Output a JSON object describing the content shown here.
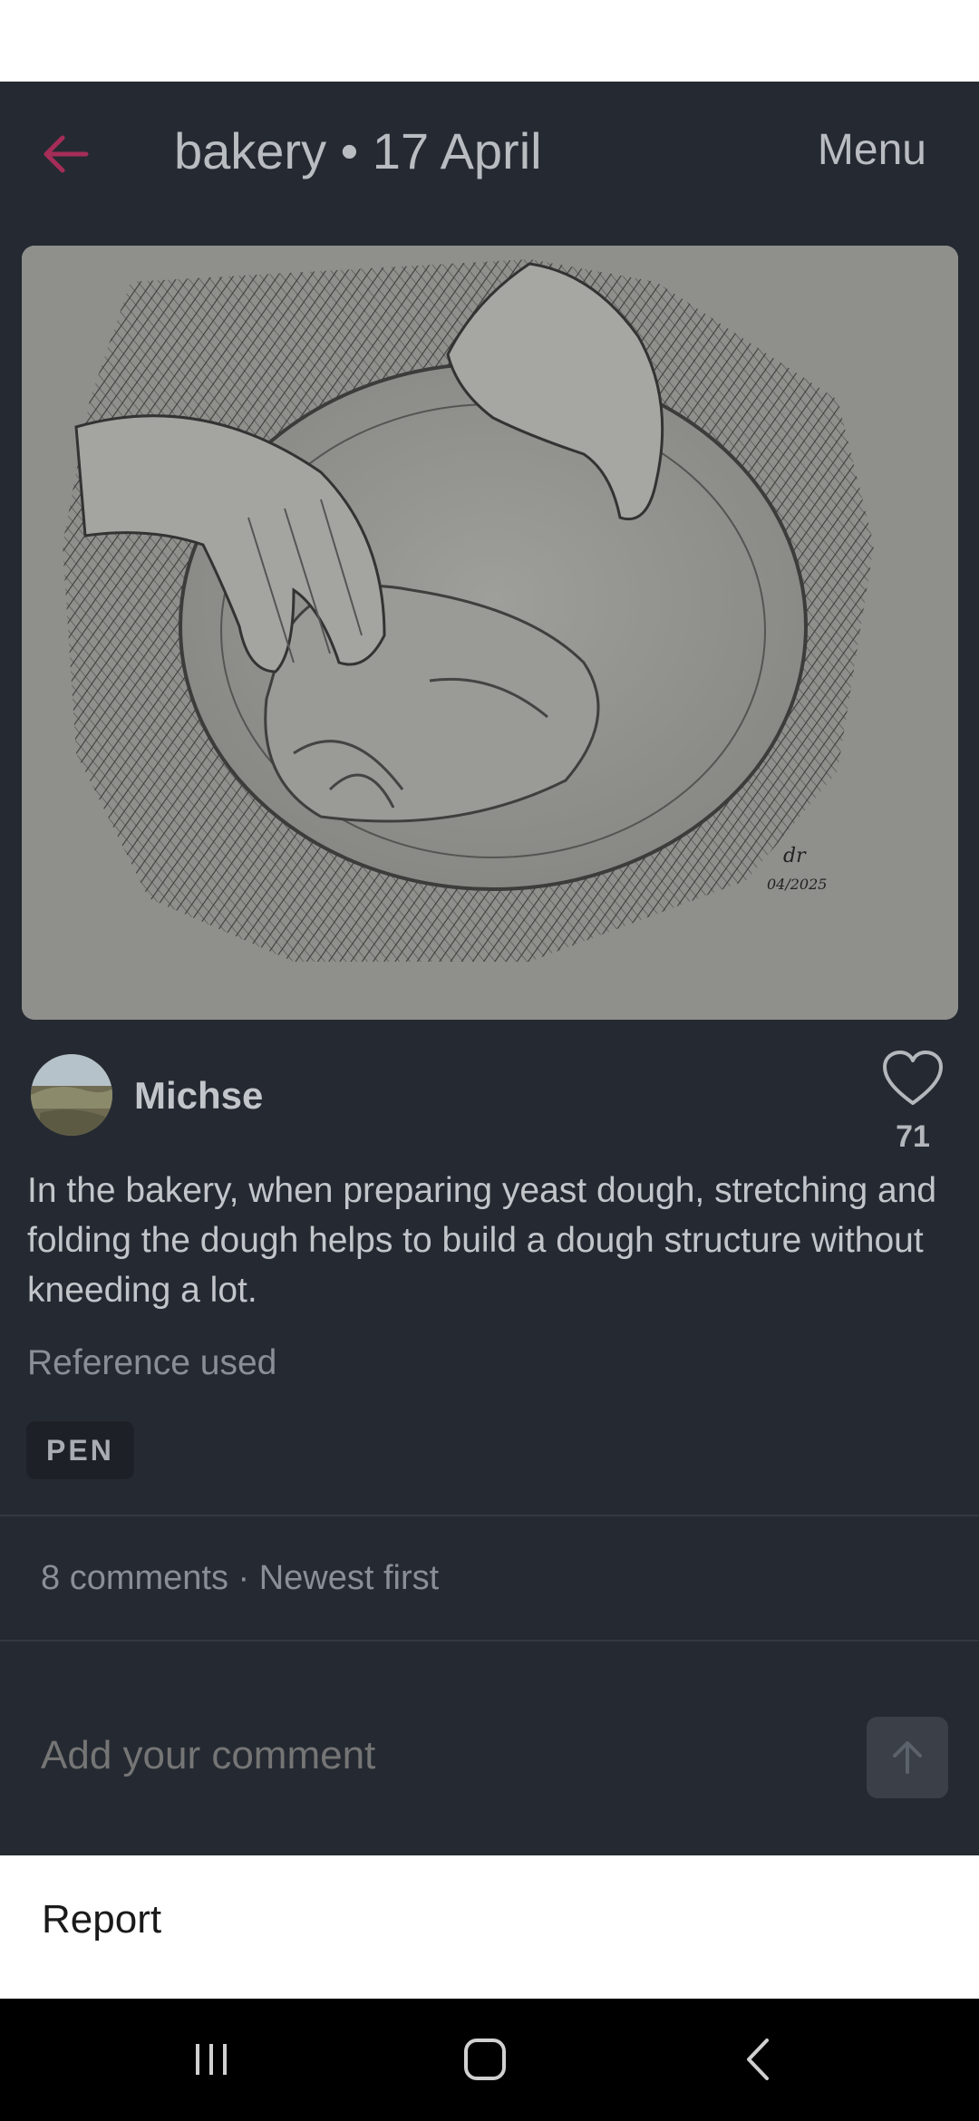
{
  "header": {
    "title": "bakery • 17 April",
    "menu_label": "Menu"
  },
  "post": {
    "author": "Michse",
    "like_count": "71",
    "description": "In the bakery, when preparing yeast dough, stretching and folding the dough helps to build a dough structure without kneeding a lot.",
    "reference_label": "Reference used",
    "tag": "PEN",
    "artwork_signature": "04/2025"
  },
  "comments": {
    "summary": "8 comments · Newest first",
    "input_placeholder": "Add your comment"
  },
  "sheet": {
    "report_label": "Report"
  },
  "colors": {
    "accent": "#b03060",
    "background": "#252a32",
    "text": "#c2c5ca",
    "muted": "#8a8f97"
  }
}
